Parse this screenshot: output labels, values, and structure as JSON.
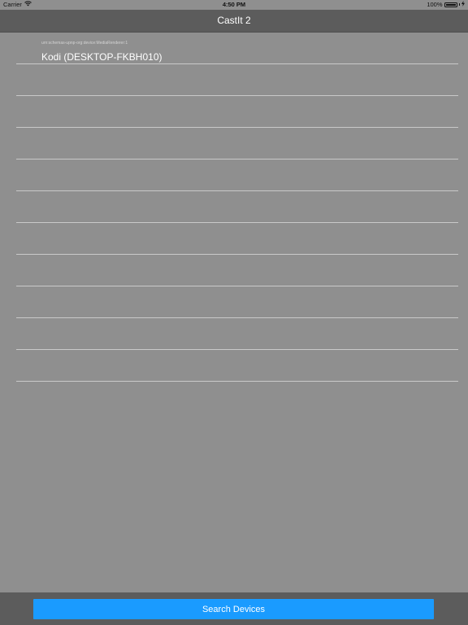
{
  "status_bar": {
    "carrier": "Carrier",
    "wifi_icon": "wifi-icon",
    "time": "4:50 PM",
    "battery_percent": "100%",
    "battery_icon": "battery-icon",
    "charging_icon": "charging-bolt-icon"
  },
  "nav": {
    "title": "CastIt 2"
  },
  "devices": [
    {
      "subtitle": "urn:schemas-upnp-org:device:MediaRenderer:1",
      "title": "Kodi (DESKTOP-FKBH010)"
    }
  ],
  "toolbar": {
    "search_label": "Search Devices"
  },
  "colors": {
    "background": "#8f8f8f",
    "nav_bar": "#5c5c5c",
    "button": "#1a9bff",
    "separator": "#c9c9c9"
  }
}
